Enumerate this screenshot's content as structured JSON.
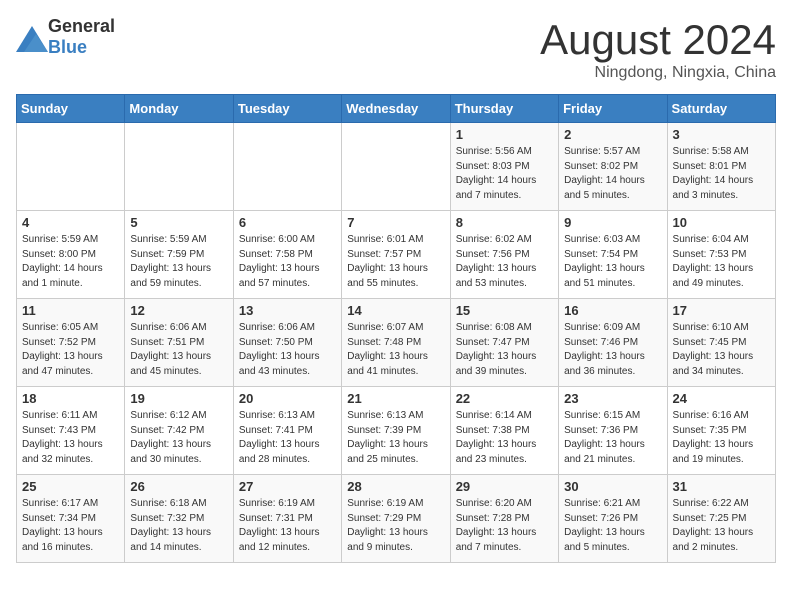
{
  "header": {
    "logo_general": "General",
    "logo_blue": "Blue",
    "title": "August 2024",
    "subtitle": "Ningdong, Ningxia, China"
  },
  "weekdays": [
    "Sunday",
    "Monday",
    "Tuesday",
    "Wednesday",
    "Thursday",
    "Friday",
    "Saturday"
  ],
  "weeks": [
    [
      {
        "day": "",
        "info": ""
      },
      {
        "day": "",
        "info": ""
      },
      {
        "day": "",
        "info": ""
      },
      {
        "day": "",
        "info": ""
      },
      {
        "day": "1",
        "info": "Sunrise: 5:56 AM\nSunset: 8:03 PM\nDaylight: 14 hours\nand 7 minutes."
      },
      {
        "day": "2",
        "info": "Sunrise: 5:57 AM\nSunset: 8:02 PM\nDaylight: 14 hours\nand 5 minutes."
      },
      {
        "day": "3",
        "info": "Sunrise: 5:58 AM\nSunset: 8:01 PM\nDaylight: 14 hours\nand 3 minutes."
      }
    ],
    [
      {
        "day": "4",
        "info": "Sunrise: 5:59 AM\nSunset: 8:00 PM\nDaylight: 14 hours\nand 1 minute."
      },
      {
        "day": "5",
        "info": "Sunrise: 5:59 AM\nSunset: 7:59 PM\nDaylight: 13 hours\nand 59 minutes."
      },
      {
        "day": "6",
        "info": "Sunrise: 6:00 AM\nSunset: 7:58 PM\nDaylight: 13 hours\nand 57 minutes."
      },
      {
        "day": "7",
        "info": "Sunrise: 6:01 AM\nSunset: 7:57 PM\nDaylight: 13 hours\nand 55 minutes."
      },
      {
        "day": "8",
        "info": "Sunrise: 6:02 AM\nSunset: 7:56 PM\nDaylight: 13 hours\nand 53 minutes."
      },
      {
        "day": "9",
        "info": "Sunrise: 6:03 AM\nSunset: 7:54 PM\nDaylight: 13 hours\nand 51 minutes."
      },
      {
        "day": "10",
        "info": "Sunrise: 6:04 AM\nSunset: 7:53 PM\nDaylight: 13 hours\nand 49 minutes."
      }
    ],
    [
      {
        "day": "11",
        "info": "Sunrise: 6:05 AM\nSunset: 7:52 PM\nDaylight: 13 hours\nand 47 minutes."
      },
      {
        "day": "12",
        "info": "Sunrise: 6:06 AM\nSunset: 7:51 PM\nDaylight: 13 hours\nand 45 minutes."
      },
      {
        "day": "13",
        "info": "Sunrise: 6:06 AM\nSunset: 7:50 PM\nDaylight: 13 hours\nand 43 minutes."
      },
      {
        "day": "14",
        "info": "Sunrise: 6:07 AM\nSunset: 7:48 PM\nDaylight: 13 hours\nand 41 minutes."
      },
      {
        "day": "15",
        "info": "Sunrise: 6:08 AM\nSunset: 7:47 PM\nDaylight: 13 hours\nand 39 minutes."
      },
      {
        "day": "16",
        "info": "Sunrise: 6:09 AM\nSunset: 7:46 PM\nDaylight: 13 hours\nand 36 minutes."
      },
      {
        "day": "17",
        "info": "Sunrise: 6:10 AM\nSunset: 7:45 PM\nDaylight: 13 hours\nand 34 minutes."
      }
    ],
    [
      {
        "day": "18",
        "info": "Sunrise: 6:11 AM\nSunset: 7:43 PM\nDaylight: 13 hours\nand 32 minutes."
      },
      {
        "day": "19",
        "info": "Sunrise: 6:12 AM\nSunset: 7:42 PM\nDaylight: 13 hours\nand 30 minutes."
      },
      {
        "day": "20",
        "info": "Sunrise: 6:13 AM\nSunset: 7:41 PM\nDaylight: 13 hours\nand 28 minutes."
      },
      {
        "day": "21",
        "info": "Sunrise: 6:13 AM\nSunset: 7:39 PM\nDaylight: 13 hours\nand 25 minutes."
      },
      {
        "day": "22",
        "info": "Sunrise: 6:14 AM\nSunset: 7:38 PM\nDaylight: 13 hours\nand 23 minutes."
      },
      {
        "day": "23",
        "info": "Sunrise: 6:15 AM\nSunset: 7:36 PM\nDaylight: 13 hours\nand 21 minutes."
      },
      {
        "day": "24",
        "info": "Sunrise: 6:16 AM\nSunset: 7:35 PM\nDaylight: 13 hours\nand 19 minutes."
      }
    ],
    [
      {
        "day": "25",
        "info": "Sunrise: 6:17 AM\nSunset: 7:34 PM\nDaylight: 13 hours\nand 16 minutes."
      },
      {
        "day": "26",
        "info": "Sunrise: 6:18 AM\nSunset: 7:32 PM\nDaylight: 13 hours\nand 14 minutes."
      },
      {
        "day": "27",
        "info": "Sunrise: 6:19 AM\nSunset: 7:31 PM\nDaylight: 13 hours\nand 12 minutes."
      },
      {
        "day": "28",
        "info": "Sunrise: 6:19 AM\nSunset: 7:29 PM\nDaylight: 13 hours\nand 9 minutes."
      },
      {
        "day": "29",
        "info": "Sunrise: 6:20 AM\nSunset: 7:28 PM\nDaylight: 13 hours\nand 7 minutes."
      },
      {
        "day": "30",
        "info": "Sunrise: 6:21 AM\nSunset: 7:26 PM\nDaylight: 13 hours\nand 5 minutes."
      },
      {
        "day": "31",
        "info": "Sunrise: 6:22 AM\nSunset: 7:25 PM\nDaylight: 13 hours\nand 2 minutes."
      }
    ]
  ],
  "colors": {
    "header_bg": "#3a7fc1",
    "logo_blue": "#3a7fc1"
  }
}
